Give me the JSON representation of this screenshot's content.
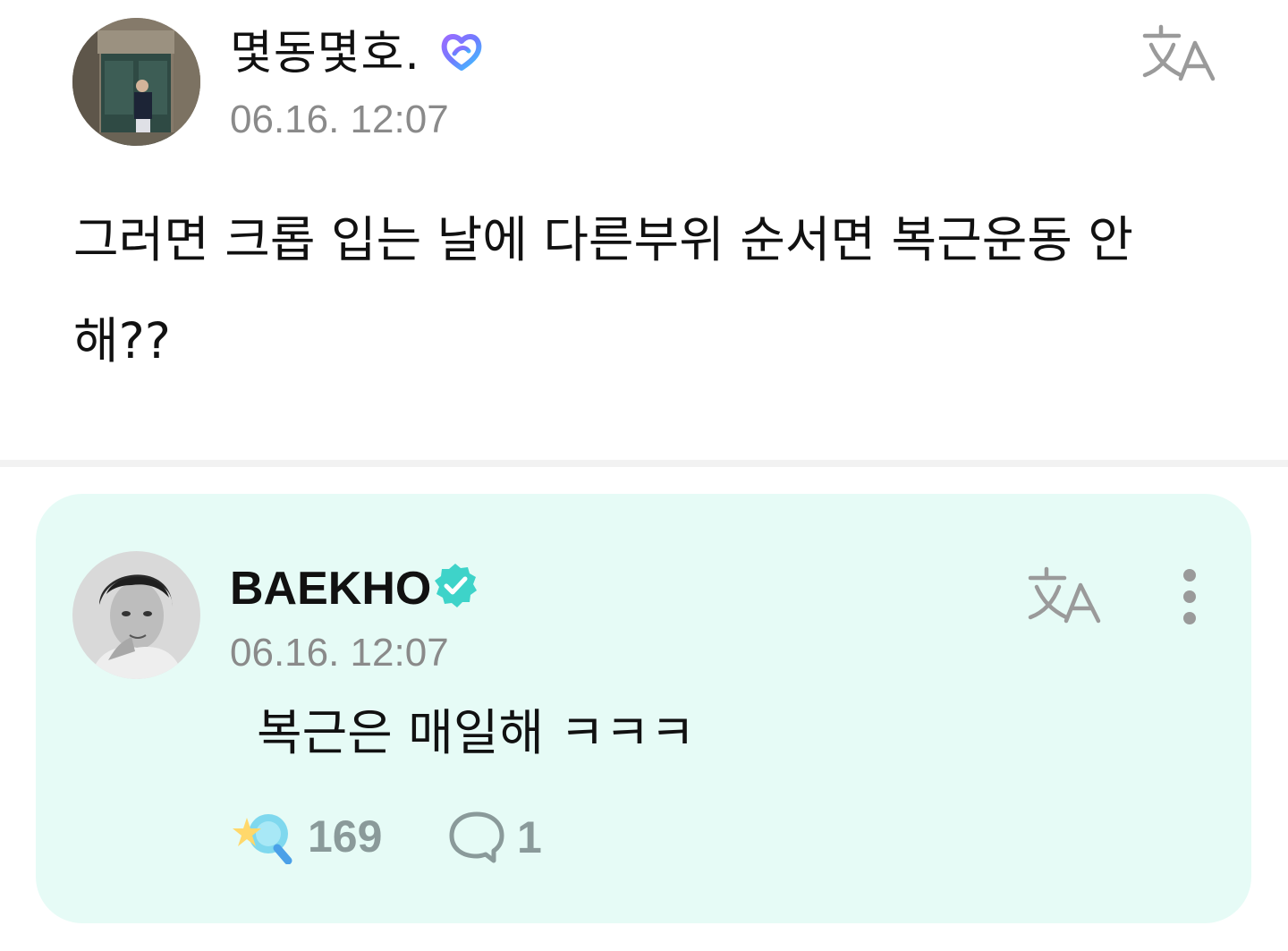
{
  "post": {
    "author_name": "몇동몇호.",
    "timestamp": "06.16. 12:07",
    "body": "그러면 크롭 입는 날에 다른부위 순서면 복근운동 안해??",
    "badge_icon": "fan-heart-badge-icon",
    "translate_icon": "translate-icon"
  },
  "reply": {
    "author_name": "BAEKHO",
    "timestamp": "06.16. 12:07",
    "body": "복근은 매일해 ㅋㅋㅋ",
    "badge_icon": "verified-badge-icon",
    "translate_icon": "translate-icon",
    "more_icon": "more-vertical-icon",
    "like_count": "169",
    "comment_count": "1"
  },
  "colors": {
    "reply_background": "#e6fbf6",
    "verified_badge": "#3ed3c9",
    "timestamp_gray": "#8a8a8a",
    "count_gray": "#8a9a9a",
    "divider": "#f2f2f2"
  }
}
